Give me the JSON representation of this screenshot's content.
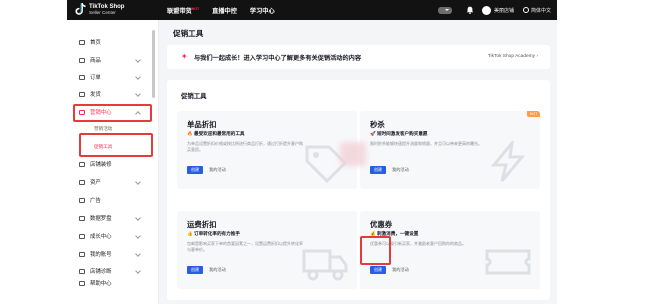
{
  "header": {
    "brand_title": "TikTok Shop",
    "brand_subtitle": "Seller Center",
    "nav": [
      {
        "label": "联盟带货",
        "badge": "HOT"
      },
      {
        "label": "直播中控",
        "badge": ""
      },
      {
        "label": "学习中心",
        "badge": ""
      }
    ],
    "user_name": "美丽店铺",
    "language": "简体中文"
  },
  "sidebar": {
    "items": [
      {
        "label": "首页",
        "icon": "home-icon"
      },
      {
        "label": "商品",
        "icon": "product-icon"
      },
      {
        "label": "订单",
        "icon": "order-icon"
      },
      {
        "label": "发货",
        "icon": "shipping-icon"
      },
      {
        "label": "营销中心",
        "icon": "megaphone-icon"
      },
      {
        "label": "店铺装修",
        "icon": "store-icon"
      },
      {
        "label": "资产",
        "icon": "wallet-icon"
      },
      {
        "label": "广告",
        "icon": "ad-icon"
      },
      {
        "label": "数据罗盘",
        "icon": "compass-icon"
      },
      {
        "label": "成长中心",
        "icon": "growth-icon"
      },
      {
        "label": "我的账号",
        "icon": "account-icon"
      },
      {
        "label": "店铺诊断",
        "icon": "diagnosis-icon"
      },
      {
        "label": "帮助中心",
        "icon": "help-icon"
      }
    ],
    "sub_items": [
      {
        "label": "营销活动"
      },
      {
        "label": "促销工具"
      }
    ]
  },
  "main": {
    "page_title": "促销工具",
    "banner": {
      "text": "与我们一起成长！进入学习中心了解更多有关促销活动的内容",
      "link": "TikTok Shop Academy"
    },
    "section_title": "促销工具",
    "cards": [
      {
        "title": "单品折扣",
        "subtitle": "🔥 最受欢迎和最常用的工具",
        "desc": "为单品设置折扣价格或按比例进行商品打折，通过打折提升客户购买意愿。",
        "create_label": "创建",
        "my_activity_label": "我的活动",
        "hot": ""
      },
      {
        "title": "秒杀",
        "subtitle": "🚀 短时间激发客户购买意愿",
        "desc": "限时秒杀能够快速提升流量和销量，并且可以带来更高的曝光。",
        "create_label": "创建",
        "my_activity_label": "我的活动",
        "hot": "HOT"
      },
      {
        "title": "运费折扣",
        "subtitle": "👍 订单转化率的有力推手",
        "desc": "包邮是影响买家下单的首要因素之一，设置运费折扣以提升转化率与客单价。",
        "create_label": "创建",
        "my_activity_label": "我的活动",
        "hot": ""
      },
      {
        "title": "优惠券",
        "subtitle": "💰 刺激消费，一键设置",
        "desc": "优惠券可以吸引新买家，并激励老客户回购你的商品。",
        "create_label": "创建",
        "my_activity_label": "我的活动",
        "hot": ""
      }
    ]
  },
  "colors": {
    "accent": "#fe2c55",
    "primary_button": "#2b5ce6",
    "highlight": "#e83a3a",
    "topbar": "#121212"
  }
}
